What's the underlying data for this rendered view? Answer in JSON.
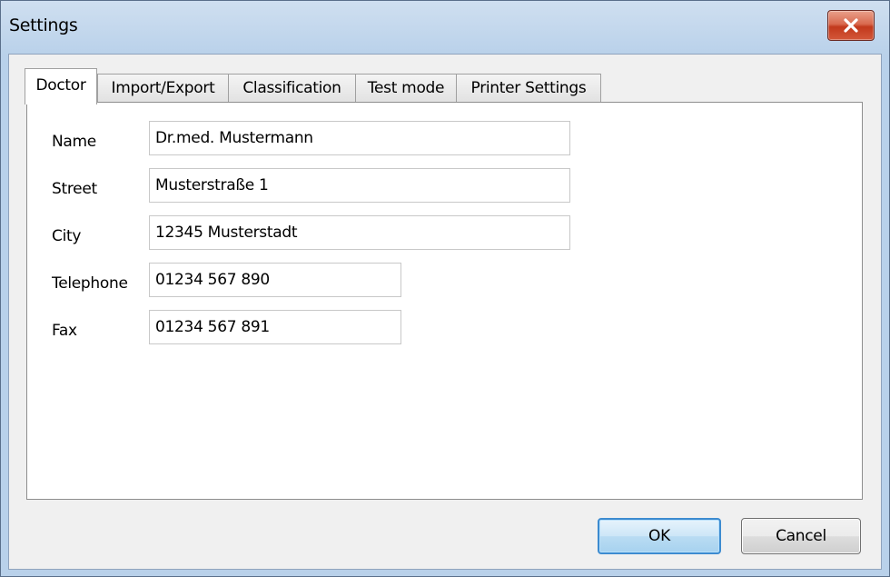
{
  "window": {
    "title": "Settings"
  },
  "tabs": [
    {
      "label": "Doctor",
      "active": true
    },
    {
      "label": "Import/Export",
      "active": false
    },
    {
      "label": "Classification",
      "active": false
    },
    {
      "label": "Test mode",
      "active": false
    },
    {
      "label": "Printer Settings",
      "active": false
    }
  ],
  "form": {
    "name": {
      "label": "Name",
      "value": "Dr.med. Mustermann"
    },
    "street": {
      "label": "Street",
      "value": "Musterstraße 1"
    },
    "city": {
      "label": "City",
      "value": "12345 Musterstadt"
    },
    "telephone": {
      "label": "Telephone",
      "value": "01234 567 890"
    },
    "fax": {
      "label": "Fax",
      "value": "01234 567 891"
    }
  },
  "buttons": {
    "ok": "OK",
    "cancel": "Cancel"
  },
  "colors": {
    "titlebar": "#b9d1ea",
    "close_button": "#c7422a",
    "ok_border": "#3c8bd0"
  },
  "icons": {
    "close": "close-icon"
  }
}
